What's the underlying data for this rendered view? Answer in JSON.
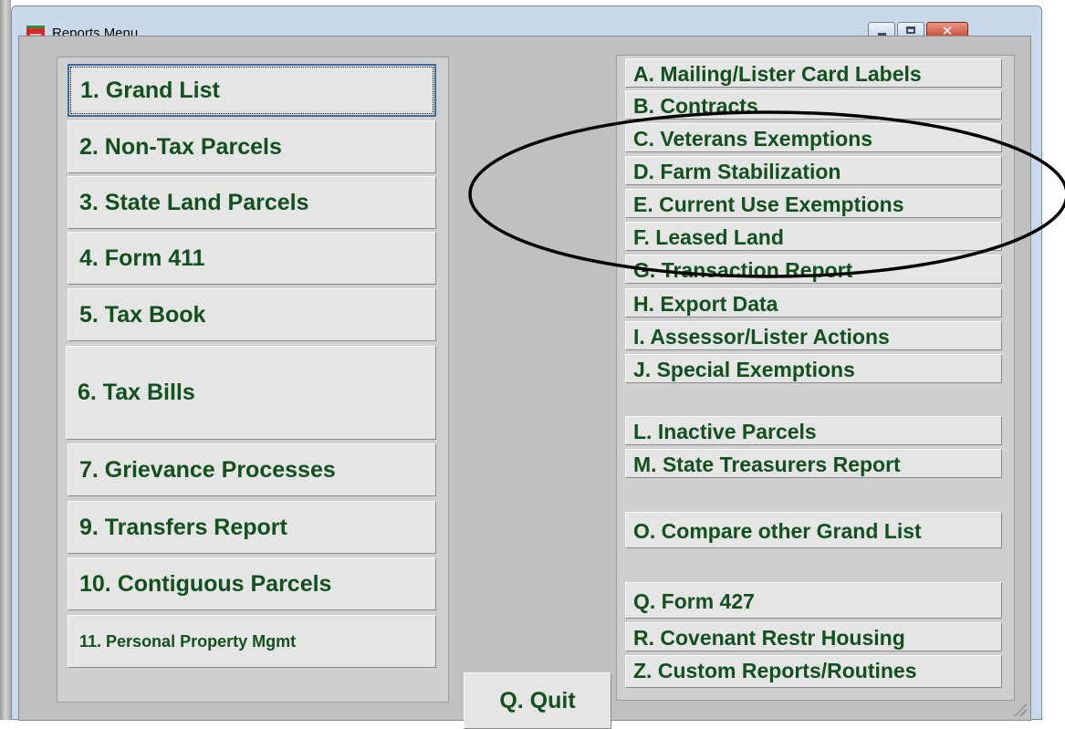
{
  "window": {
    "title": "Reports Menu"
  },
  "left_menu": [
    {
      "key": "1",
      "label": "1.  Grand List"
    },
    {
      "key": "2",
      "label": "2.  Non-Tax Parcels"
    },
    {
      "key": "3",
      "label": "3.  State Land Parcels"
    },
    {
      "key": "4",
      "label": "4.  Form 411"
    },
    {
      "key": "5",
      "label": "5. Tax Book"
    },
    {
      "key": "6",
      "label": "6. Tax Bills"
    },
    {
      "key": "7",
      "label": "7. Grievance Processes"
    },
    {
      "key": "9",
      "label": "9. Transfers Report"
    },
    {
      "key": "10",
      "label": "10. Contiguous Parcels"
    },
    {
      "key": "11",
      "label": "11. Personal Property Mgmt"
    }
  ],
  "right_menu": [
    {
      "key": "A",
      "label": "A. Mailing/Lister Card Labels"
    },
    {
      "key": "B",
      "label": "B. Contracts"
    },
    {
      "key": "C",
      "label": "C. Veterans Exemptions"
    },
    {
      "key": "D",
      "label": "D. Farm Stabilization"
    },
    {
      "key": "E",
      "label": "E. Current Use Exemptions"
    },
    {
      "key": "F",
      "label": "F. Leased Land"
    },
    {
      "key": "G",
      "label": "G. Transaction Report"
    },
    {
      "key": "H",
      "label": "H. Export Data"
    },
    {
      "key": "I",
      "label": "I. Assessor/Lister Actions"
    },
    {
      "key": "J",
      "label": "J. Special Exemptions"
    },
    {
      "key": "L",
      "label": "L. Inactive Parcels"
    },
    {
      "key": "M",
      "label": "M. State Treasurers Report"
    },
    {
      "key": "O",
      "label": "O. Compare other Grand List"
    },
    {
      "key": "Q",
      "label": "Q. Form 427"
    },
    {
      "key": "R",
      "label": "R. Covenant Restr Housing"
    },
    {
      "key": "Z",
      "label": "Z. Custom Reports/Routines"
    }
  ],
  "quit": {
    "label": "Q.  Quit"
  },
  "title_buttons": {
    "close_glyph": "✕"
  }
}
